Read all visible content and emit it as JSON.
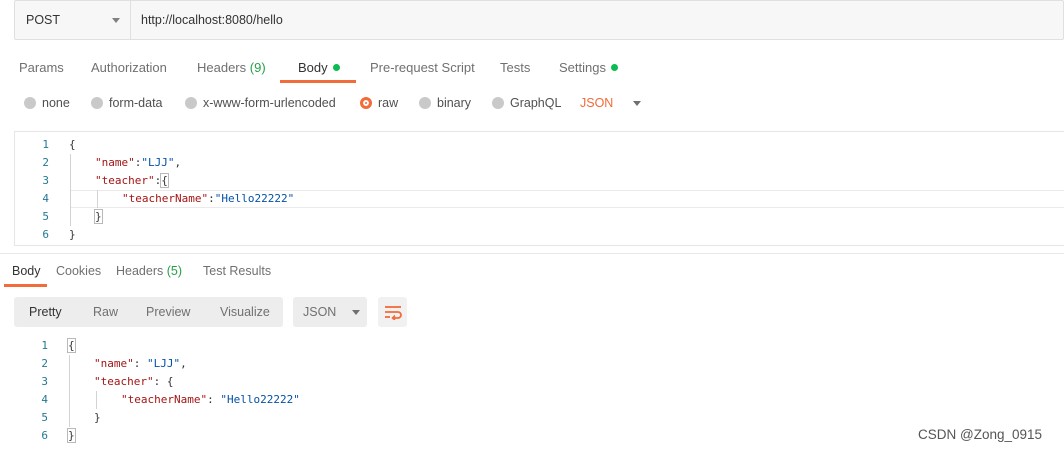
{
  "request": {
    "method": "POST",
    "url": "http://localhost:8080/hello"
  },
  "request_tabs": [
    {
      "label": "Params"
    },
    {
      "label": "Authorization"
    },
    {
      "label": "Headers",
      "count": "(9)"
    },
    {
      "label": "Body",
      "active": true,
      "dot": true
    },
    {
      "label": "Pre-request Script"
    },
    {
      "label": "Tests"
    },
    {
      "label": "Settings",
      "dot": true
    }
  ],
  "body_types": [
    {
      "label": "none"
    },
    {
      "label": "form-data"
    },
    {
      "label": "x-www-form-urlencoded"
    },
    {
      "label": "raw",
      "selected": true
    },
    {
      "label": "binary"
    },
    {
      "label": "GraphQL"
    }
  ],
  "raw_format": "JSON",
  "request_body": {
    "line_numbers": [
      "1",
      "2",
      "3",
      "4",
      "5",
      "6"
    ],
    "open_brace": "{",
    "name_key": "\"name\"",
    "name_value": "\"LJJ\"",
    "teacher_key": "\"teacher\"",
    "teacher_name_key": "\"teacherName\"",
    "teacher_name_value": "\"Hello22222\"",
    "close_brace": "}"
  },
  "response_tabs": [
    {
      "label": "Body",
      "active": true
    },
    {
      "label": "Cookies"
    },
    {
      "label": "Headers",
      "count": "(5)"
    },
    {
      "label": "Test Results"
    }
  ],
  "response_toolbar": {
    "views": [
      "Pretty",
      "Raw",
      "Preview",
      "Visualize"
    ],
    "format": "JSON"
  },
  "response_body": {
    "line_numbers": [
      "1",
      "2",
      "3",
      "4",
      "5",
      "6"
    ],
    "name_key": "\"name\"",
    "name_value": "\"LJJ\"",
    "teacher_key": "\"teacher\"",
    "teacher_name_key": "\"teacherName\"",
    "teacher_name_value": "\"Hello22222\""
  },
  "watermark": "CSDN @Zong_0915",
  "colors": {
    "accent": "#f26b3a",
    "status_dot": "#0cbb52",
    "json_key": "#a31515",
    "json_string": "#0451a5",
    "line_number": "#237893"
  }
}
